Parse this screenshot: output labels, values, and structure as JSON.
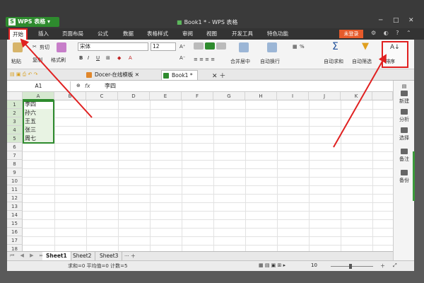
{
  "app": {
    "brand_label": "WPS 表格",
    "logo_glyph": "S",
    "window_title": "Book1 * - WPS 表格"
  },
  "menu": {
    "tabs": [
      {
        "label": "开始",
        "active": true
      },
      {
        "label": "插入"
      },
      {
        "label": "页面布局"
      },
      {
        "label": "公式"
      },
      {
        "label": "数据"
      },
      {
        "label": "表格样式"
      },
      {
        "label": "审阅"
      },
      {
        "label": "视图"
      },
      {
        "label": "开发工具"
      },
      {
        "label": "特色功能"
      }
    ],
    "login_label": "未登录"
  },
  "ribbon": {
    "paste_label": "粘贴",
    "cut_label": "剪切",
    "copy_label": "复制",
    "format_painter_label": "格式刷",
    "font_name": "宋体",
    "font_size": "12",
    "merge_label": "合并居中",
    "wrap_label": "自动换行",
    "percent_label": "%",
    "autosum_label": "自动求和",
    "autofilter_label": "自动筛选",
    "sort_label": "排序"
  },
  "doc_tabs": [
    {
      "label": "Docer-在线模板"
    },
    {
      "label": "Book1 *"
    }
  ],
  "formula_bar": {
    "name_box": "A1",
    "fx_label": "fx",
    "value": "李四"
  },
  "grid": {
    "columns": [
      "A",
      "B",
      "C",
      "D",
      "E",
      "F",
      "G",
      "H",
      "I",
      "J",
      "K"
    ],
    "rows": [
      "1",
      "2",
      "3",
      "4",
      "5",
      "6",
      "7",
      "8",
      "9",
      "10",
      "11",
      "12",
      "13",
      "14",
      "15",
      "16",
      "17",
      "18"
    ],
    "cells_a": [
      "李四",
      "孙六",
      "王五",
      "张三",
      "周七"
    ]
  },
  "right_panel": [
    {
      "label": "新建"
    },
    {
      "label": "分析"
    },
    {
      "label": "选择"
    },
    {
      "label": "备注"
    },
    {
      "label": "备份"
    }
  ],
  "sheets": [
    {
      "label": "Sheet1",
      "active": true
    },
    {
      "label": "Sheet2"
    },
    {
      "label": "Sheet3"
    }
  ],
  "status": {
    "summary": "求和=0  平均值=0  计数=5",
    "zoom": "10"
  },
  "colors": {
    "accent_green": "#2e8b2e",
    "highlight_red": "#e02020",
    "login_orange": "#e65a2a"
  }
}
